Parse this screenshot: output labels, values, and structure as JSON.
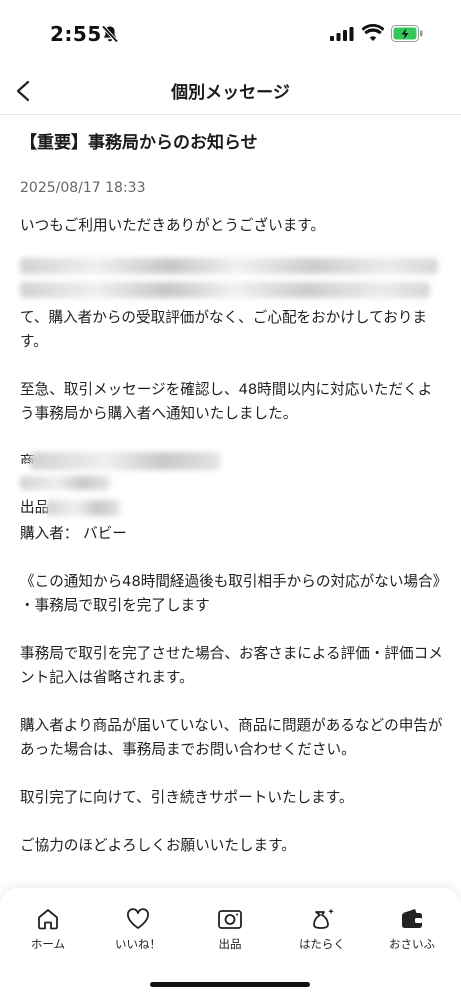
{
  "status_bar": {
    "time": "2:55",
    "icons": [
      "bell-slash-icon",
      "signal-icon",
      "wifi-icon",
      "battery-charging-icon"
    ]
  },
  "header": {
    "title": "個別メッセージ",
    "back_icon": "chevron-left-icon"
  },
  "message": {
    "title": "【重要】事務局からのお知らせ",
    "date": "2025/08/17 18:33",
    "greeting": "いつもご利用いただきありがとうございます。",
    "p1_visible": "て、購入者からの受取評価がなく、ご心配をおかけしております。",
    "p2": "至急、取引メッセージを確認し、48時間以内に対応いただくよう事務局から購入者へ通知いたしました。",
    "item_label_partial": "商品",
    "seller_label_partial": "出品",
    "buyer_line": "購入者： バビー",
    "condition_heading": "《この通知から48時間経過後も取引相手からの対応がない場合》",
    "condition_item": "・事務局で取引を完了します",
    "p3": "事務局で取引を完了させた場合、お客さまによる評価・評価コメント記入は省略されます。",
    "p4": "購入者より商品が届いていない、商品に問題があるなどの申告があった場合は、事務局までお問い合わせください。",
    "p5": "取引完了に向けて、引き続きサポートいたします。",
    "p6": "ご協力のほどよろしくお願いいたします。"
  },
  "tabs": [
    {
      "label": "ホーム",
      "icon": "home-icon"
    },
    {
      "label": "いいね！",
      "icon": "heart-icon"
    },
    {
      "label": "出品",
      "icon": "camera-icon"
    },
    {
      "label": "はたらく",
      "icon": "bag-sparkle-icon"
    },
    {
      "label": "おさいふ",
      "icon": "wallet-icon"
    }
  ],
  "colors": {
    "text": "#1f1f1f",
    "muted": "#666666",
    "divider": "#e6e6e6",
    "battery_green": "#34c759"
  }
}
